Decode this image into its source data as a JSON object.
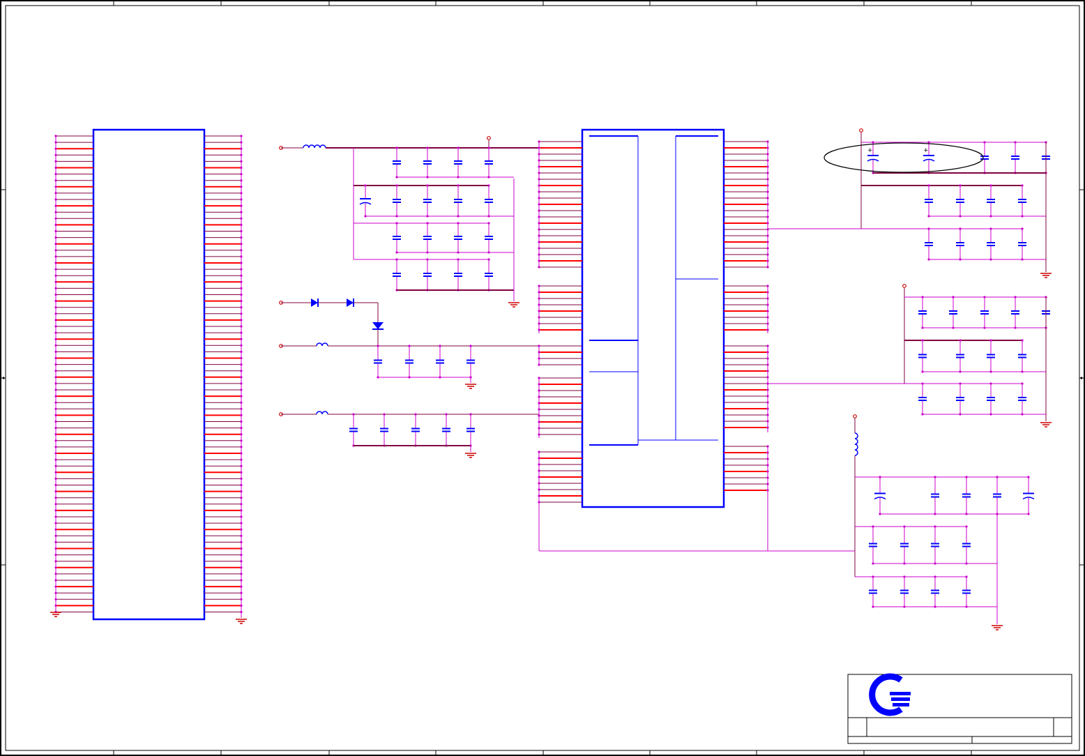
{
  "sheet": {
    "border_color": "#000000",
    "zone_columns": 5,
    "zone_rows": 3
  },
  "colors": {
    "pin_red": "#ff0000",
    "wire_maroon": "#800040",
    "wire_magenta": "#cc00cc",
    "part_blue": "#0000ff",
    "junction": "#cc00cc",
    "net_label_red": "#cc0000",
    "highlight_ellipse": "#000000"
  },
  "connector": {
    "name": "board-connector",
    "pin_rows": 76
  },
  "ic": {
    "name": "main-ic"
  },
  "title_block": {
    "logo": "company-logo",
    "title": "",
    "document_number": "",
    "revision": "",
    "sheet": "",
    "date": ""
  }
}
